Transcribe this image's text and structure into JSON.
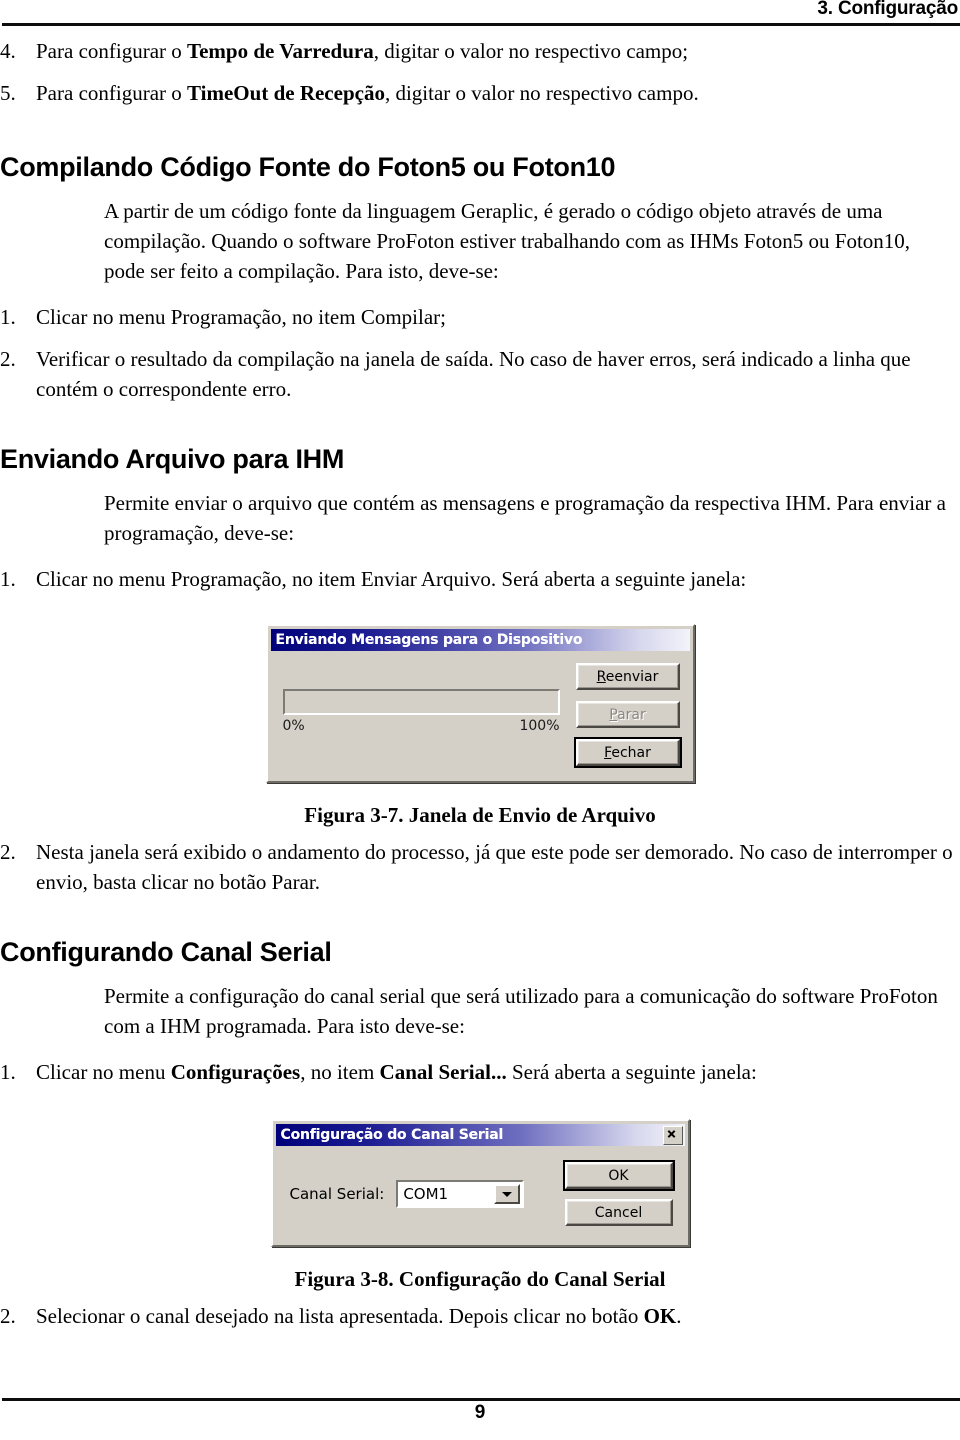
{
  "header": {
    "chapter_title": "3. Configuração"
  },
  "top_list": [
    {
      "num": "4.",
      "pre": "Para configurar o ",
      "bold": "Tempo de Varredura",
      "post": ", digitar o valor no respectivo campo;"
    },
    {
      "num": "5.",
      "pre": "Para configurar o ",
      "bold": "TimeOut de Recepção",
      "post": ", digitar o valor no respectivo campo."
    }
  ],
  "sections": [
    {
      "heading": "Compilando Código Fonte do Foton5 ou Foton10",
      "paragraph": "A partir de um código fonte da linguagem Geraplic, é gerado o código objeto através de uma compilação. Quando o software ProFoton estiver trabalhando com as IHMs Foton5 ou Foton10, pode ser feito a compilação. Para isto, deve-se:",
      "steps": [
        {
          "num": "1.",
          "text": "Clicar no menu Programação, no item Compilar;"
        },
        {
          "num": "2.",
          "text": "Verificar o resultado da compilação na janela de saída. No caso de haver erros, será indicado a linha que contém o correspondente erro."
        }
      ]
    },
    {
      "heading": "Enviando Arquivo para IHM",
      "paragraph": "Permite enviar o arquivo que contém as mensagens e programação da respectiva IHM. Para enviar a programação, deve-se:",
      "steps": [
        {
          "num": "1.",
          "text": "Clicar no menu Programação, no item Enviar Arquivo. Será aberta a seguinte janela:"
        }
      ],
      "after_steps": [
        {
          "num": "2.",
          "text": "Nesta janela será exibido o andamento do processo, já que este pode ser demorado. No caso de interromper o envio, basta clicar no botão Parar."
        }
      ]
    },
    {
      "heading": "Configurando Canal Serial",
      "paragraph": "Permite a configuração do canal serial que será utilizado para a comunicação do software ProFoton com a IHM programada. Para isto deve-se:",
      "step_pre": "Clicar no menu ",
      "step_bold1": "Configurações",
      "step_mid": ", no item ",
      "step_bold2": "Canal Serial...",
      "step_post": " Será aberta a seguinte janela:",
      "step_num": "1.",
      "after_step": {
        "num": "2.",
        "pre": "Selecionar o canal desejado na lista apresentada. Depois clicar no botão ",
        "bold": "OK",
        "post": "."
      }
    }
  ],
  "figure_send": {
    "title": "Enviando Mensagens para o Dispositivo",
    "progress_min_label": "0%",
    "progress_max_label": "100%",
    "progress_percent": 0,
    "buttons": [
      {
        "accel": "R",
        "rest": "eenviar",
        "state": "enabled",
        "default": false
      },
      {
        "accel": "P",
        "rest": "arar",
        "state": "disabled",
        "default": false
      },
      {
        "accel": "F",
        "rest": "echar",
        "state": "enabled",
        "default": true
      }
    ],
    "caption": "Figura 3-7. Janela de Envio de Arquivo"
  },
  "figure_serial": {
    "title": "Configuração do Canal Serial",
    "close_label": "×",
    "field_label": "Canal Serial:",
    "field_value": "COM1",
    "ok_label": "OK",
    "cancel_label": "Cancel",
    "caption": "Figura 3-8. Configuração do Canal Serial"
  },
  "footer": {
    "page_number": "9"
  },
  "colors": {
    "title_bar_start": "#00007a",
    "title_bar_end": "#f3f3fa",
    "dialog_face": "#d4d0c8",
    "text": "#000000"
  }
}
